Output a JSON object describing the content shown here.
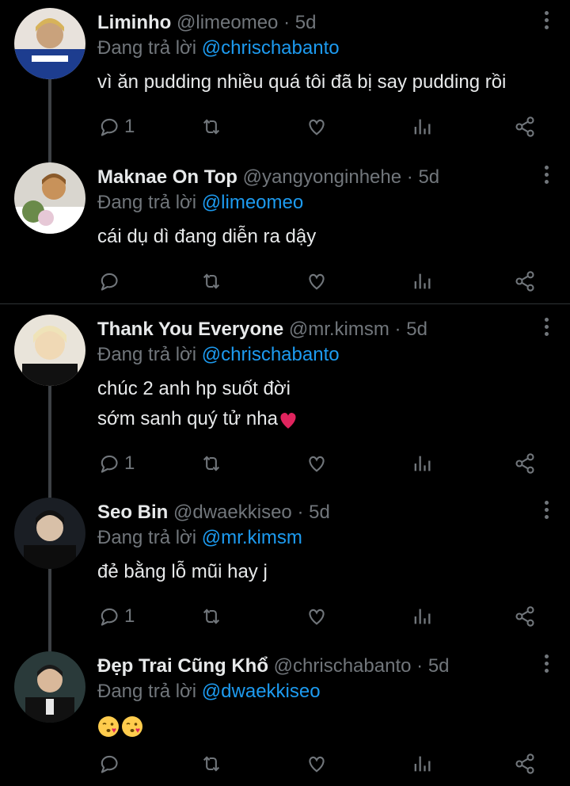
{
  "replying_label": "Đang trả lời",
  "tweets": [
    {
      "name": "Liminho",
      "handle": "@limeomeo",
      "dot": "·",
      "time": "5d",
      "reply_to": "@chrischabanto",
      "lines": [
        "vì ăn pudding nhiều quá tôi đã bị say pudding rồi"
      ],
      "reply_count": "1",
      "avatar_colors": [
        "#e8e2dc",
        "#1d3d8f",
        "#c9a27c"
      ]
    },
    {
      "name": "Maknae On Top",
      "handle": "@yangyonginhehe",
      "dot": "·",
      "time": "5d",
      "reply_to": "@limeomeo",
      "lines": [
        "cái dụ dì đang diễn ra dậy"
      ],
      "reply_count": "",
      "avatar_colors": [
        "#d9d6cf",
        "#6a8a4a",
        "#c8925a"
      ]
    },
    {
      "name": "Thank You Everyone",
      "handle": "@mr.kimsm",
      "dot": "·",
      "time": "5d",
      "reply_to": "@chrischabanto",
      "lines": [
        "chúc 2 anh hp suốt đời",
        "sớm sanh quý tử nha"
      ],
      "reply_count": "1",
      "avatar_colors": [
        "#e9e4da",
        "#111111",
        "#f0d9b5"
      ]
    },
    {
      "name": "Seo Bin",
      "handle": "@dwaekkiseo",
      "dot": "·",
      "time": "5d",
      "reply_to": "@mr.kimsm",
      "lines": [
        "đẻ bằng lỗ mũi hay j"
      ],
      "reply_count": "1",
      "avatar_colors": [
        "#1a1e24",
        "#0d0d0d",
        "#d8c0a8"
      ]
    },
    {
      "name": "Đẹp Trai Cũng Khổ",
      "handle": "@chrischabanto",
      "dot": "·",
      "time": "5d",
      "reply_to": "@dwaekkiseo",
      "lines": [
        ""
      ],
      "reply_count": "",
      "avatar_colors": [
        "#2a3a3a",
        "#111111",
        "#d9b89a"
      ]
    }
  ],
  "colors": {
    "background": "#000000",
    "text": "#e7e9ea",
    "muted": "#71767b",
    "link": "#1d9bf0",
    "heart_emoji": "#e0245e"
  },
  "icons": [
    "reply-icon",
    "retweet-icon",
    "like-icon",
    "stats-icon",
    "share-icon",
    "more-icon"
  ]
}
